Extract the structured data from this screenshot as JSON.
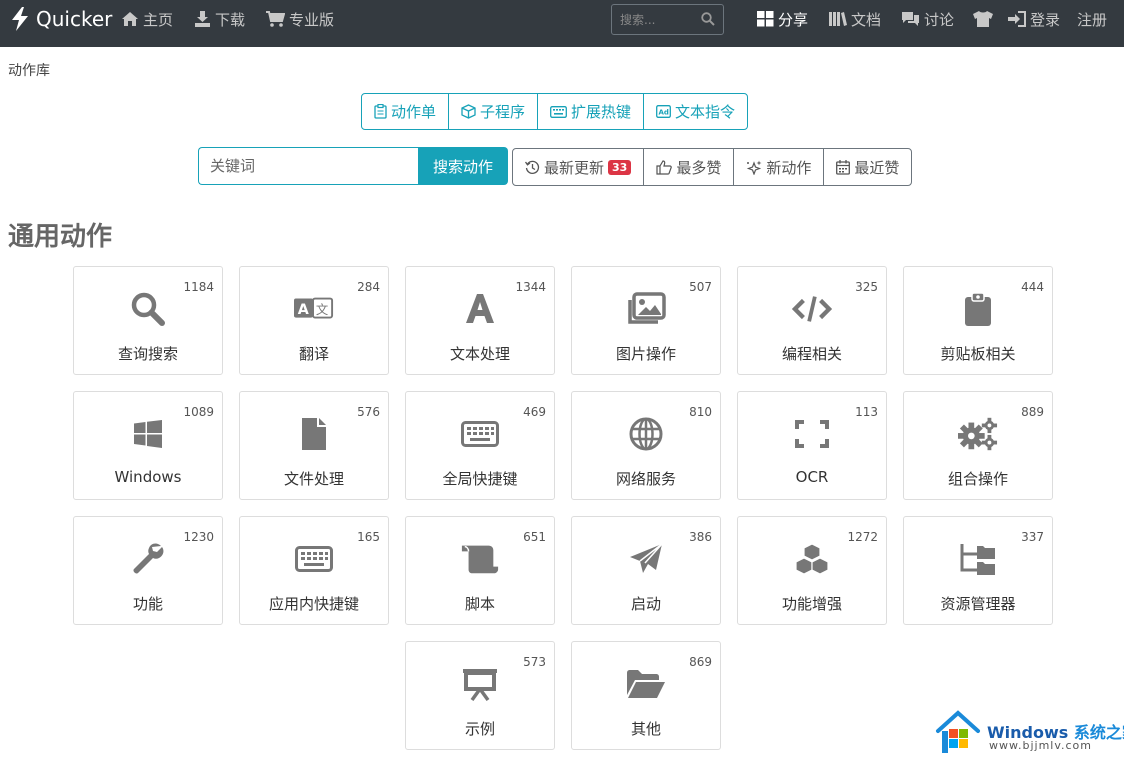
{
  "nav": {
    "brand": "Quicker",
    "home": "主页",
    "download": "下载",
    "pro": "专业版",
    "search_placeholder": "搜索...",
    "share": "分享",
    "docs": "文档",
    "discuss": "讨论",
    "login": "登录",
    "register": "注册"
  },
  "breadcrumb": "动作库",
  "tabs": [
    {
      "label": "动作单",
      "icon": "clipboard-icon"
    },
    {
      "label": "子程序",
      "icon": "cube-icon"
    },
    {
      "label": "扩展热键",
      "icon": "keyboard-icon"
    },
    {
      "label": "文本指令",
      "icon": "ad-icon"
    }
  ],
  "search": {
    "placeholder": "关键词",
    "button": "搜索动作"
  },
  "filters": {
    "latest": "最新更新",
    "latest_badge": "33",
    "most_liked": "最多赞",
    "new_actions": "新动作",
    "recent_liked": "最近赞"
  },
  "section_title": "通用动作",
  "categories": [
    {
      "label": "查询搜索",
      "count": "1184",
      "icon": "search-icon"
    },
    {
      "label": "翻译",
      "count": "284",
      "icon": "translate-icon"
    },
    {
      "label": "文本处理",
      "count": "1344",
      "icon": "font-icon"
    },
    {
      "label": "图片操作",
      "count": "507",
      "icon": "images-icon"
    },
    {
      "label": "编程相关",
      "count": "325",
      "icon": "code-icon"
    },
    {
      "label": "剪贴板相关",
      "count": "444",
      "icon": "clipboard-icon"
    },
    {
      "label": "Windows",
      "count": "1089",
      "icon": "windows-icon"
    },
    {
      "label": "文件处理",
      "count": "576",
      "icon": "file-icon"
    },
    {
      "label": "全局快捷键",
      "count": "469",
      "icon": "keyboard-icon"
    },
    {
      "label": "网络服务",
      "count": "810",
      "icon": "globe-icon"
    },
    {
      "label": "OCR",
      "count": "113",
      "icon": "expand-icon"
    },
    {
      "label": "组合操作",
      "count": "889",
      "icon": "cogs-icon"
    },
    {
      "label": "功能",
      "count": "1230",
      "icon": "wrench-icon"
    },
    {
      "label": "应用内快捷键",
      "count": "165",
      "icon": "keyboard-icon"
    },
    {
      "label": "脚本",
      "count": "651",
      "icon": "scroll-icon"
    },
    {
      "label": "启动",
      "count": "386",
      "icon": "paper-plane-icon"
    },
    {
      "label": "功能增强",
      "count": "1272",
      "icon": "cubes-icon"
    },
    {
      "label": "资源管理器",
      "count": "337",
      "icon": "folder-tree-icon"
    },
    {
      "label": "示例",
      "count": "573",
      "icon": "presentation-icon"
    },
    {
      "label": "其他",
      "count": "869",
      "icon": "folder-open-icon"
    }
  ],
  "watermark": {
    "line1_a": "Windows",
    "line1_b": "系统之家",
    "line2": "www.bjjmlv.com"
  }
}
